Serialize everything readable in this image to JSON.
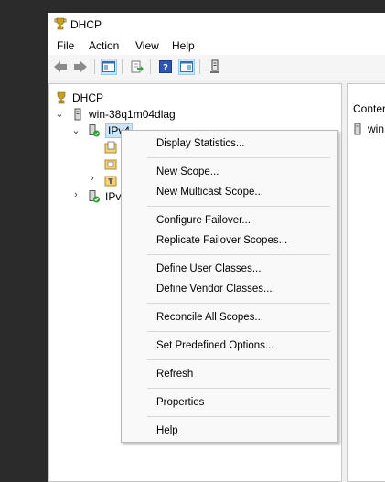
{
  "window": {
    "title": "DHCP"
  },
  "menu": [
    "File",
    "Action",
    "View",
    "Help"
  ],
  "tree": {
    "root": "DHCP",
    "server": "win-38q1m04dlag",
    "ipv4": "IPv4",
    "ipv6": "IPv"
  },
  "right": {
    "header": "Conter",
    "row": "win"
  },
  "context_menu": {
    "display_statistics": "Display Statistics...",
    "new_scope": "New Scope...",
    "new_multicast_scope": "New Multicast Scope...",
    "configure_failover": "Configure Failover...",
    "replicate_failover": "Replicate Failover Scopes...",
    "define_user_classes": "Define User Classes...",
    "define_vendor_classes": "Define Vendor Classes...",
    "reconcile_all": "Reconcile All Scopes...",
    "set_predefined": "Set Predefined Options...",
    "refresh": "Refresh",
    "properties": "Properties",
    "help": "Help"
  },
  "colors": {
    "selection": "#cce4f7",
    "menu_bg": "#f9f9f9",
    "desktop": "#2b2b2b"
  }
}
